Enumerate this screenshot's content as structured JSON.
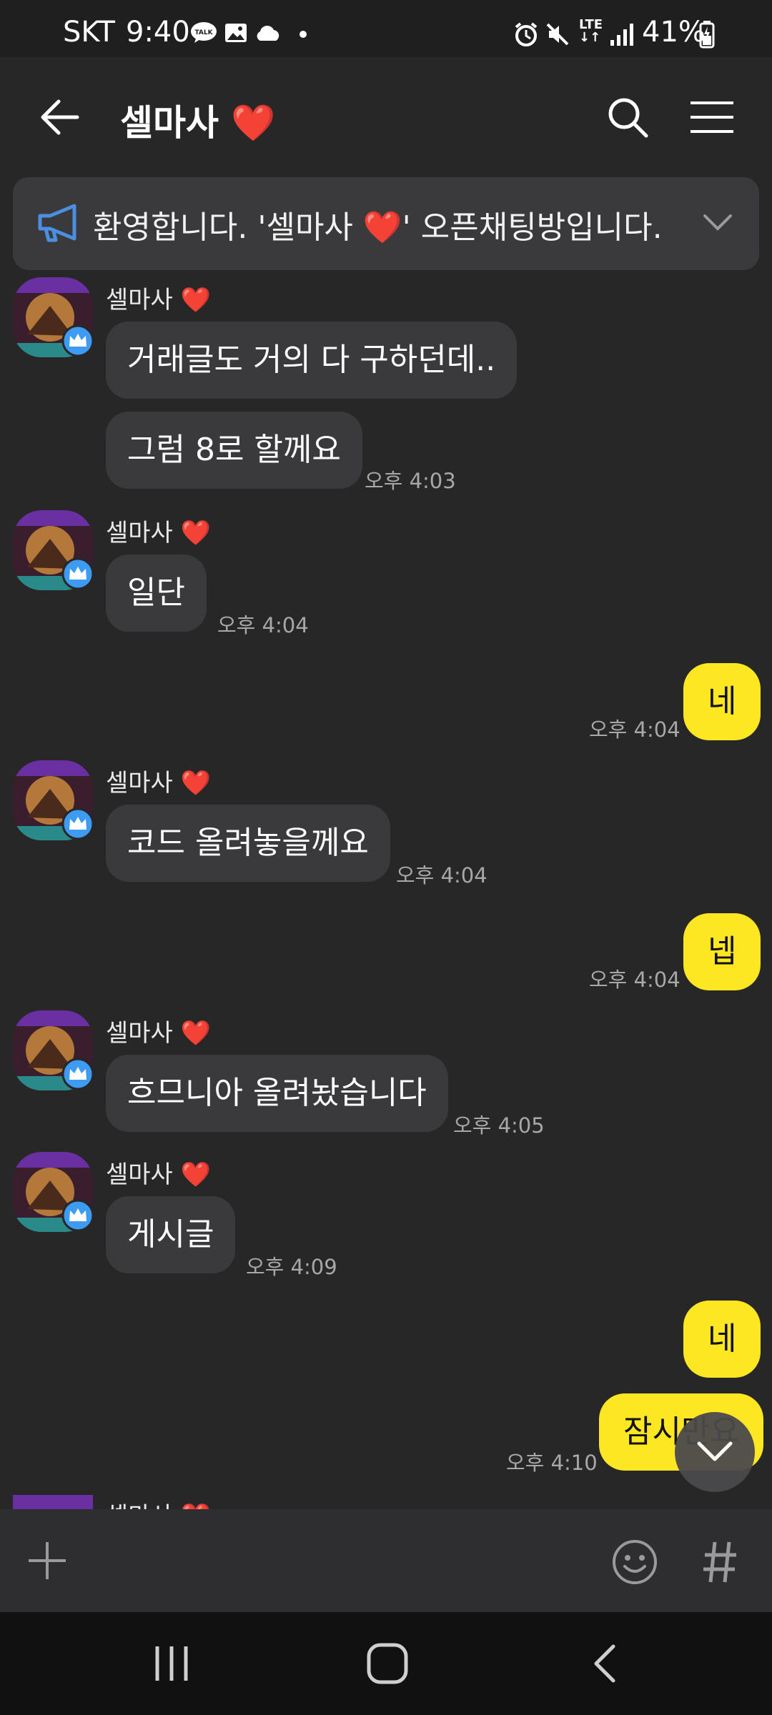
{
  "status_bar": {
    "carrier": "SKT",
    "time": "9:40",
    "battery": "41%",
    "network": "LTE",
    "icons": [
      "talk-icon",
      "image-icon",
      "cloud-icon",
      "alarm-icon",
      "mute-icon",
      "signal-icon",
      "battery-icon"
    ]
  },
  "header": {
    "title": "셀마사",
    "title_emoji": "❤️",
    "back_icon": "back-arrow-icon",
    "search_icon": "search-icon",
    "menu_icon": "hamburger-menu-icon"
  },
  "notice": {
    "text": "환영합니다. '셀마사 ❤️' 오픈채팅방입니다.",
    "icon": "megaphone-icon"
  },
  "messages": {
    "sender_name": "셀마사 ❤️",
    "m1": "거래글도 거의 다 구하던데..",
    "m2": "그럼 8로 할께요",
    "m2_time": "오후 4:03",
    "m3": "일단",
    "m3_time": "오후 4:04",
    "m4": "네",
    "m4_time": "오후 4:04",
    "m5": "코드 올려놓을께요",
    "m5_time": "오후 4:04",
    "m6": "넵",
    "m6_time": "오후 4:04",
    "m7": "흐므니아 올려놨습니다",
    "m7_time": "오후 4:05",
    "m8": "게시글",
    "m8_time": "오후 4:09",
    "m9": "네",
    "m10": "잠시만요",
    "m10_time": "오후 4:10"
  },
  "colors": {
    "background": "#272727",
    "incoming_bubble": "#3a3a3c",
    "outgoing_bubble": "#fde723",
    "heart": "#e8302a",
    "admin_badge": "#3d9bf2"
  }
}
